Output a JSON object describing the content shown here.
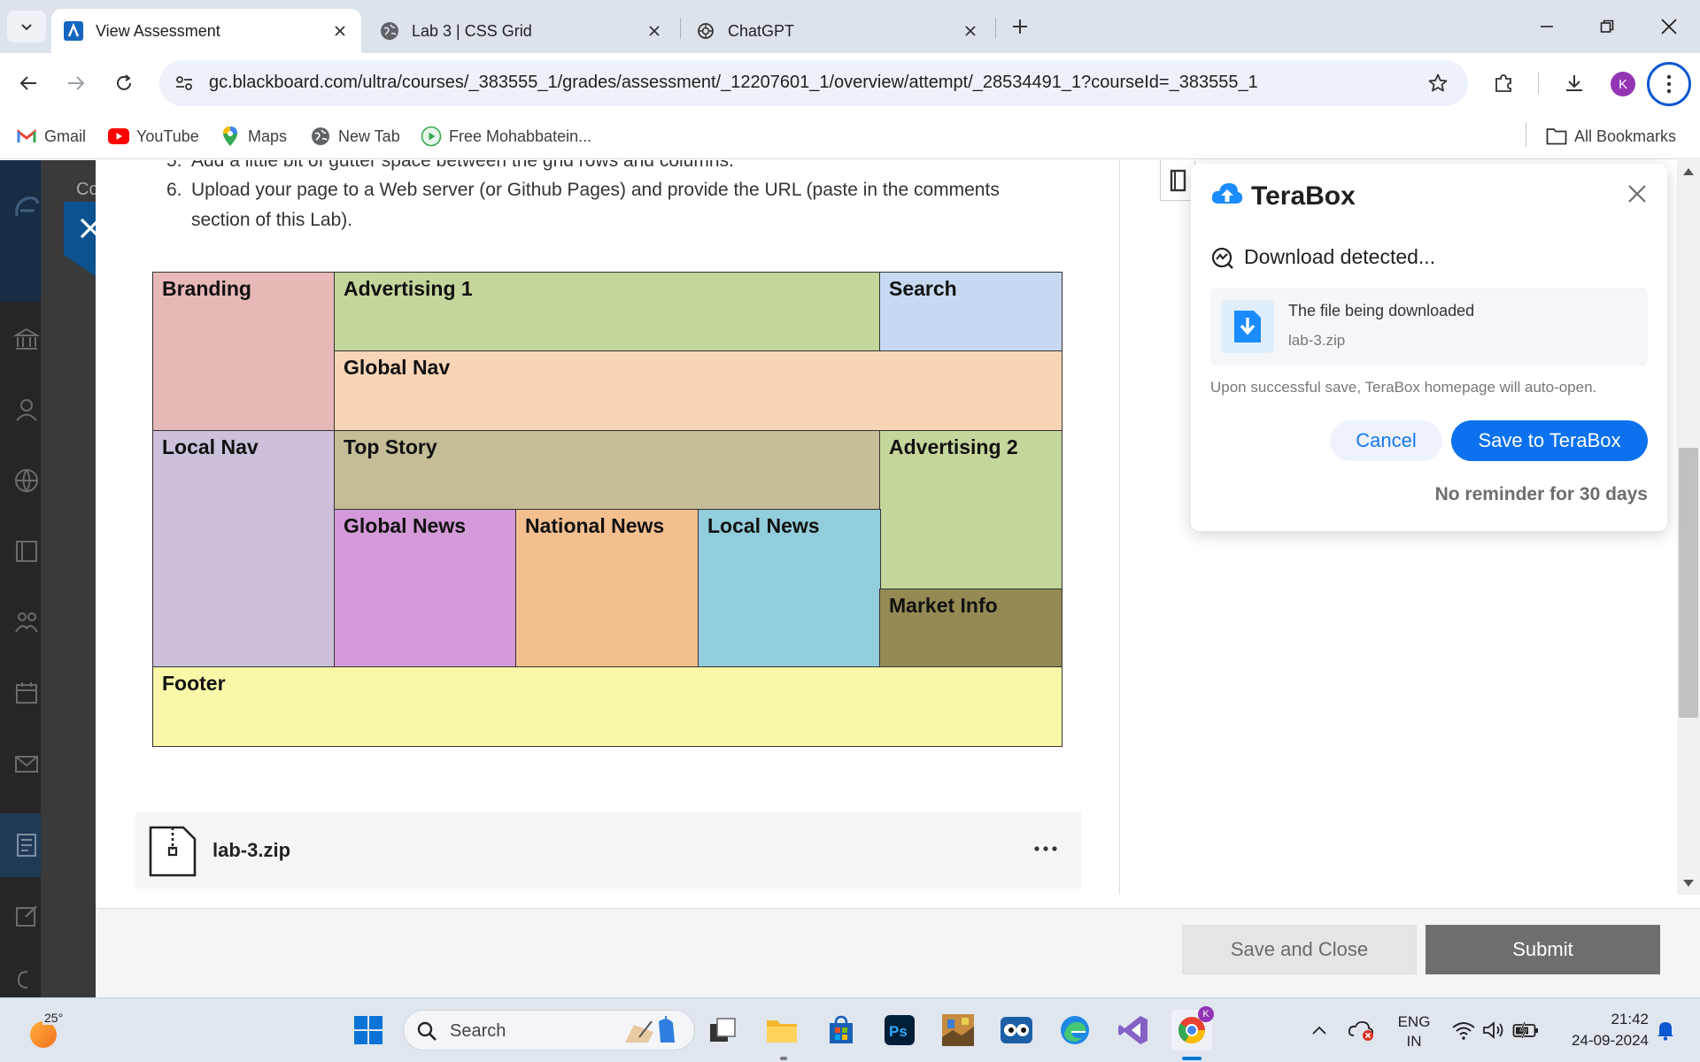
{
  "browser": {
    "tabs": [
      {
        "title": "View Assessment",
        "active": true,
        "icon": "blackboard-icon"
      },
      {
        "title": "Lab 3 | CSS Grid",
        "active": false,
        "icon": "globe-icon"
      },
      {
        "title": "ChatGPT",
        "active": false,
        "icon": "openai-icon"
      }
    ],
    "url": "gc.blackboard.com/ultra/courses/_383555_1/grades/assessment/_12207601_1/overview/attempt/_28534491_1?courseId=_383555_1",
    "profile_initial": "K",
    "bookmarks": [
      {
        "label": "Gmail",
        "icon": "gmail-icon"
      },
      {
        "label": "YouTube",
        "icon": "youtube-icon"
      },
      {
        "label": "Maps",
        "icon": "maps-icon"
      },
      {
        "label": "New Tab",
        "icon": "globe-icon"
      },
      {
        "label": "Free Mohabbatein...",
        "icon": "play-icon"
      }
    ],
    "all_bookmarks": "All Bookmarks"
  },
  "sidebar": {
    "partial_label": "Co"
  },
  "instructions": [
    {
      "num": "5.",
      "text": "Add a little bit of gutter space between the grid rows and columns."
    },
    {
      "num": "6.",
      "text": "Upload your page to a Web server (or Github Pages) and provide the URL (paste in the comments"
    },
    {
      "num": "",
      "text": "section of this Lab)."
    }
  ],
  "grid_layout": {
    "cells": [
      {
        "label": "Branding",
        "color": "#e6b8b7"
      },
      {
        "label": "Advertising 1",
        "color": "#c3d69b"
      },
      {
        "label": "Search",
        "color": "#c6d9f0"
      },
      {
        "label": "Global Nav",
        "color": "#f8d5b7"
      },
      {
        "label": "Local Nav",
        "color": "#ccc0da"
      },
      {
        "label": "Top Story",
        "color": "#c4bd97"
      },
      {
        "label": "Advertising 2",
        "color": "#c3d69b"
      },
      {
        "label": "Global News",
        "color": "#d499d8"
      },
      {
        "label": "National News",
        "color": "#f3bf8f"
      },
      {
        "label": "Local News",
        "color": "#92cddc"
      },
      {
        "label": "Market Info",
        "color": "#948a54"
      },
      {
        "label": "Footer",
        "color": "#f8f8a8"
      }
    ]
  },
  "attachment": {
    "file_name": "lab-3.zip"
  },
  "footer_buttons": {
    "save_close": "Save and Close",
    "submit": "Submit"
  },
  "terabox": {
    "brand": "TeraBox",
    "detected": "Download detected...",
    "file_title": "The file being downloaded",
    "file_name": "lab-3.zip",
    "note": "Upon successful save, TeraBox homepage will auto-open.",
    "cancel": "Cancel",
    "save": "Save to TeraBox",
    "no_reminder": "No reminder for 30 days"
  },
  "taskbar": {
    "temperature": "25°",
    "search_placeholder": "Search",
    "language_line1": "ENG",
    "language_line2": "IN",
    "time": "21:42",
    "date": "24-09-2024",
    "apps": [
      "windows-start-icon",
      "task-view-icon",
      "file-explorer-icon",
      "microsoft-store-icon",
      "photoshop-icon",
      "game-icon",
      "eyes-app-icon",
      "edge-icon",
      "visual-studio-icon",
      "chrome-icon"
    ]
  },
  "colors": {
    "blackboard_blue": "#0c5290",
    "terabox_blue": "#0b71ee",
    "submit_gray": "#6e6e6e"
  }
}
